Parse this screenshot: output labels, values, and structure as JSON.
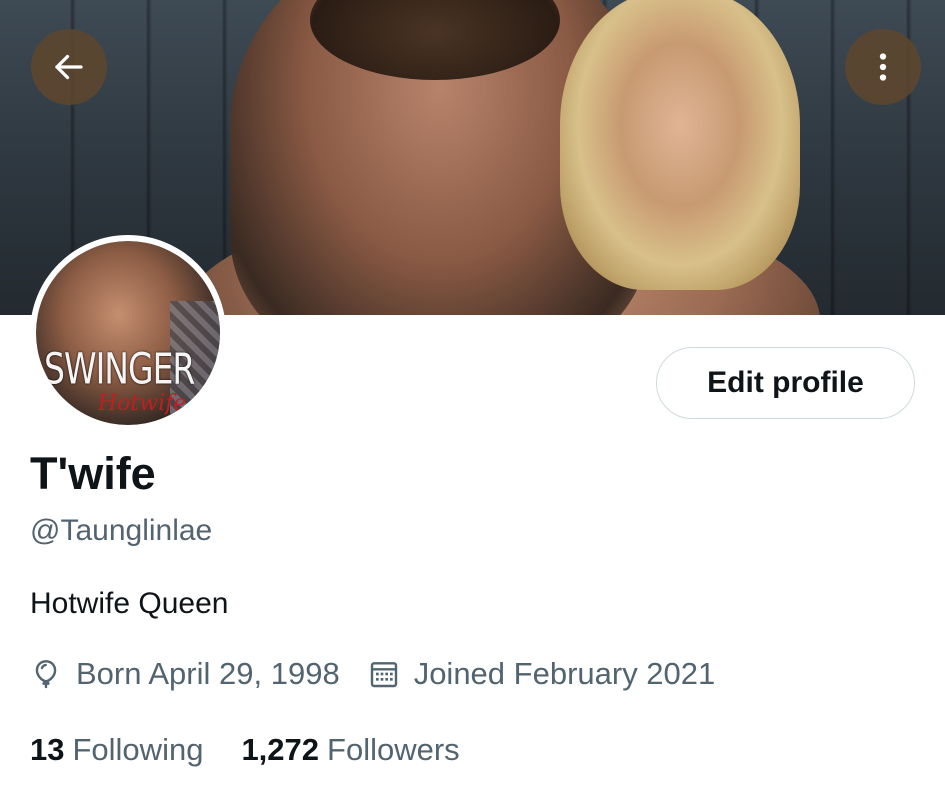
{
  "header": {
    "back_icon": "arrow-left-icon",
    "more_icon": "more-vertical-icon"
  },
  "avatar": {
    "text": "SWINGER",
    "script": "Hotwife"
  },
  "profile": {
    "edit_label": "Edit profile",
    "display_name": "T'wife",
    "handle": "@Taunglinlae",
    "bio": "Hotwife Queen",
    "birth_icon": "balloon-icon",
    "born": "Born April 29, 1998",
    "joined_icon": "calendar-icon",
    "joined": "Joined February 2021",
    "following_count": "13",
    "following_label": "Following",
    "followers_count": "1,272",
    "followers_label": "Followers"
  },
  "colors": {
    "text_primary": "#0f1419",
    "text_secondary": "#536471",
    "button_border": "#cfd9de",
    "overlay_button": "#5f462d"
  }
}
